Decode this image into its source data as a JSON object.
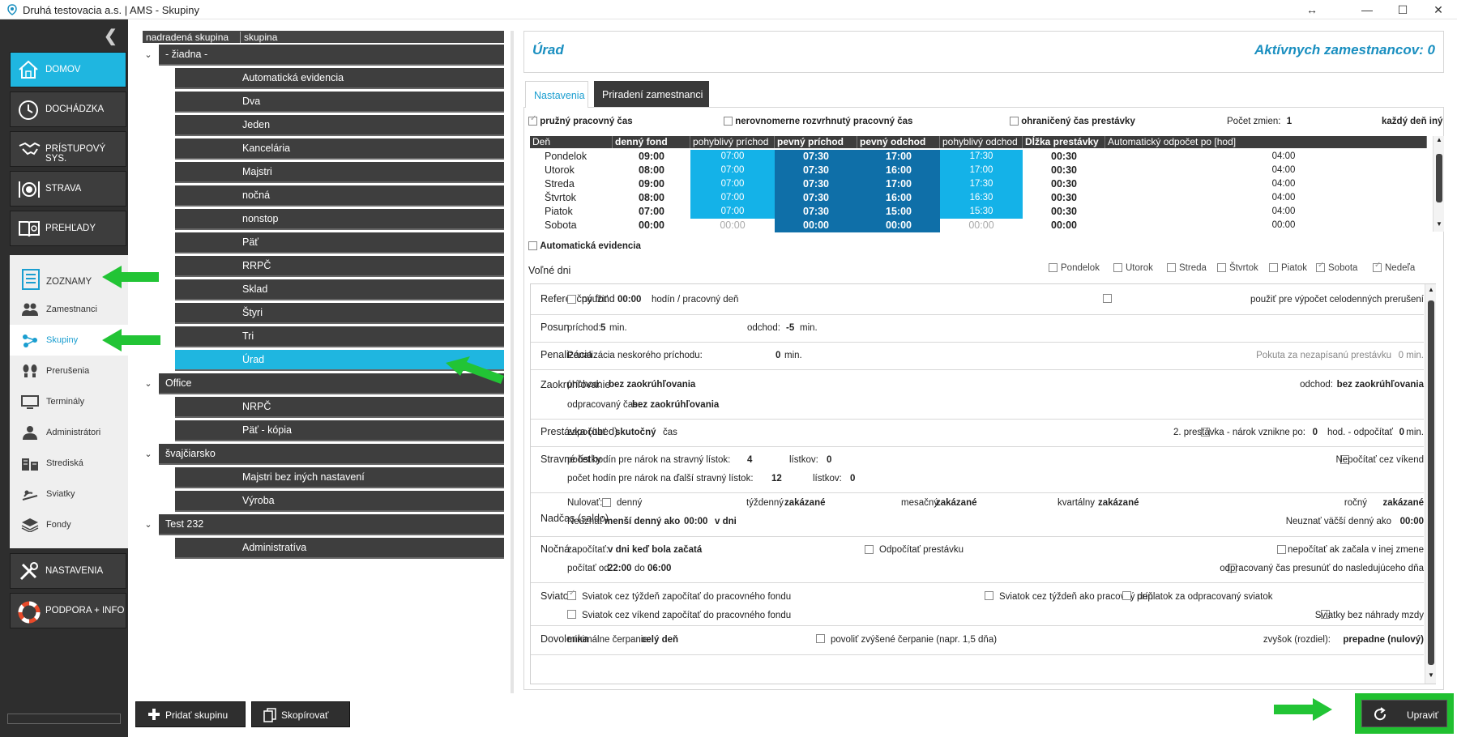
{
  "window": {
    "title": "Druhá testovacia a.s. | AMS - Skupiny"
  },
  "nav": {
    "home": "DOMOV",
    "attendance": "DOCHÁDZKA",
    "access": "PRÍSTUPOVÝ SYS.",
    "food": "STRAVA",
    "reports": "PREHĽADY",
    "lists": "ZOZNAMY",
    "settings": "NASTAVENIA",
    "support": "PODPORA + INFO"
  },
  "submenu": [
    "Zamestnanci",
    "Skupiny",
    "Prerušenia",
    "Terminály",
    "Administrátori",
    "Strediská",
    "Sviatky",
    "Fondy"
  ],
  "tree": {
    "col1": "nadradená skupina",
    "col2": "skupina",
    "groups": [
      {
        "name": "- žiadna -",
        "children": [
          "Automatická evidencia",
          "Dva",
          "Jeden",
          "Kancelária",
          "Majstri",
          "nočná",
          "nonstop",
          "Päť",
          "RRPČ",
          "Sklad",
          "Štyri",
          "Tri",
          "Úrad"
        ]
      },
      {
        "name": "Office",
        "children": [
          "NRPČ",
          "Päť - kópia"
        ]
      },
      {
        "name": "švajčiarsko",
        "children": [
          "Majstri bez iných nastavení",
          "Výroba"
        ]
      },
      {
        "name": "Test 232",
        "children": [
          "Administratíva"
        ]
      }
    ]
  },
  "buttons": {
    "add": "Pridať skupinu",
    "copy": "Skopírovať",
    "edit": "Upraviť"
  },
  "header": {
    "group": "Úrad",
    "active": "Aktívnych zamestnancov: 0"
  },
  "tabs": [
    "Nastavenia",
    "Priradení zamestnanci"
  ],
  "opts": {
    "flex": "pružný pracovný čas",
    "uneven": "nerovnomerne rozvrhnutý pracovný čas",
    "limited": "ohraničený čas prestávky",
    "shifts_label": "Počet zmien:",
    "shifts": "1",
    "every": "každý deň iný",
    "auto": "Automatická evidencia",
    "free": "Voľné dni"
  },
  "days_header": [
    "Deň",
    "denný fond",
    "pohyblivý príchod",
    "pevný príchod",
    "pevný odchod",
    "pohyblivý odchod",
    "Dĺžka prestávky",
    "Automatický odpočet po [hod]"
  ],
  "days": [
    [
      "Pondelok",
      "09:00",
      "07:00",
      "07:30",
      "17:00",
      "17:30",
      "00:30",
      "04:00"
    ],
    [
      "Utorok",
      "08:00",
      "07:00",
      "07:30",
      "16:00",
      "17:00",
      "00:30",
      "04:00"
    ],
    [
      "Streda",
      "09:00",
      "07:00",
      "07:30",
      "17:00",
      "17:30",
      "00:30",
      "04:00"
    ],
    [
      "Štvrtok",
      "08:00",
      "07:00",
      "07:30",
      "16:00",
      "16:30",
      "00:30",
      "04:00"
    ],
    [
      "Piatok",
      "07:00",
      "07:00",
      "07:30",
      "15:00",
      "15:30",
      "00:30",
      "04:00"
    ],
    [
      "Sobota",
      "00:00",
      "00:00",
      "00:00",
      "00:00",
      "00:00",
      "00:00",
      "00:00"
    ]
  ],
  "weekdays": [
    "Pondelok",
    "Utorok",
    "Streda",
    "Štvrtok",
    "Piatok",
    "Sobota",
    "Nedeľa"
  ],
  "s": {
    "ref": {
      "t": "Referenčný fond",
      "use": "použiť",
      "val": "00:00",
      "unit": "hodín / pracovný deň",
      "right": "použiť pre výpočet celodenných prerušení"
    },
    "posun": {
      "t": "Posun",
      "p": "príchod:",
      "pv": "5",
      "min": "min.",
      "o": "odchod:",
      "ov": "-5"
    },
    "pen": {
      "t": "Penalizácia",
      "l": "Penalizácia neskorého príchodu:",
      "v": "0",
      "min": "min.",
      "r": "Pokuta za nezapísanú prestávku",
      "rv": "0 min."
    },
    "zaok": {
      "t": "Zaokrúhľovanie",
      "p": "príchod:",
      "pv": "bez zaokrúhľovania",
      "o": "odchod:",
      "ov": "bez zaokrúhľovania",
      "w": "odpracovaný čas:",
      "wv": "bez zaokrúhľovania"
    },
    "prest": {
      "t": "Prestávka (obed)",
      "l": "započítať",
      "v": "skutočný",
      "u": "čas",
      "r": "2. prestávka - nárok vznikne po:",
      "r1": "0",
      "r2": "hod. - odpočítať",
      "r3": "0",
      "r4": "min."
    },
    "strav": {
      "t": "Stravné lístky",
      "a": "počet hodín pre nárok na stravný lístok:",
      "av": "4",
      "b": "lístkov:",
      "bv": "0",
      "c": "počet hodín pre nárok na ďalší stravný lístok:",
      "cv": "12",
      "d": "lístkov:",
      "dv": "0",
      "r": "Nepočítať cez víkend"
    },
    "nad": {
      "t": "Nadčas (saldo)",
      "nul": "Nulovať:",
      "d": "denný",
      "w": "týždenný",
      "wv": "zakázané",
      "m": "mesačný",
      "mv": "zakázané",
      "q": "kvartálny",
      "qv": "zakázané",
      "y": "ročný",
      "yv": "zakázané",
      "ne": "Neuznať",
      "nev": "menší denný ako",
      "nev2": "00:00",
      "nev3": "v dni",
      "nr": "Neuznať väčší denný ako",
      "nrv": "00:00"
    },
    "noc": {
      "t": "Nočná",
      "z": "započítať:",
      "zv": "v dni keď bola začatá",
      "odp": "Odpočítať prestávku",
      "nep": "nepočítať ak začala v inej zmene",
      "pc": "počítať od",
      "od": "22:00",
      "do": "do",
      "dov": "06:00",
      "pres": "odpracovaný čas presunúť do nasledujúceho dňa"
    },
    "svi": {
      "t": "Sviatok",
      "a": "Sviatok cez týždeň započítať do pracovného fondu",
      "b": "Sviatok cez týždeň ako pracovný deň",
      "c": "príplatok za odpracovaný sviatok",
      "d": "Sviatok cez víkend započítať do pracovného fondu",
      "e": "Sviatky bez náhrady mzdy"
    },
    "dov": {
      "t": "Dovolenka",
      "l": "minimálne čerpanie:",
      "v": "celý deň",
      "m": "povoliť zvýšené čerpanie (napr. 1,5 dňa)",
      "r": "zvyšok (rozdiel):",
      "rv": "prepadne (nulový)"
    }
  }
}
